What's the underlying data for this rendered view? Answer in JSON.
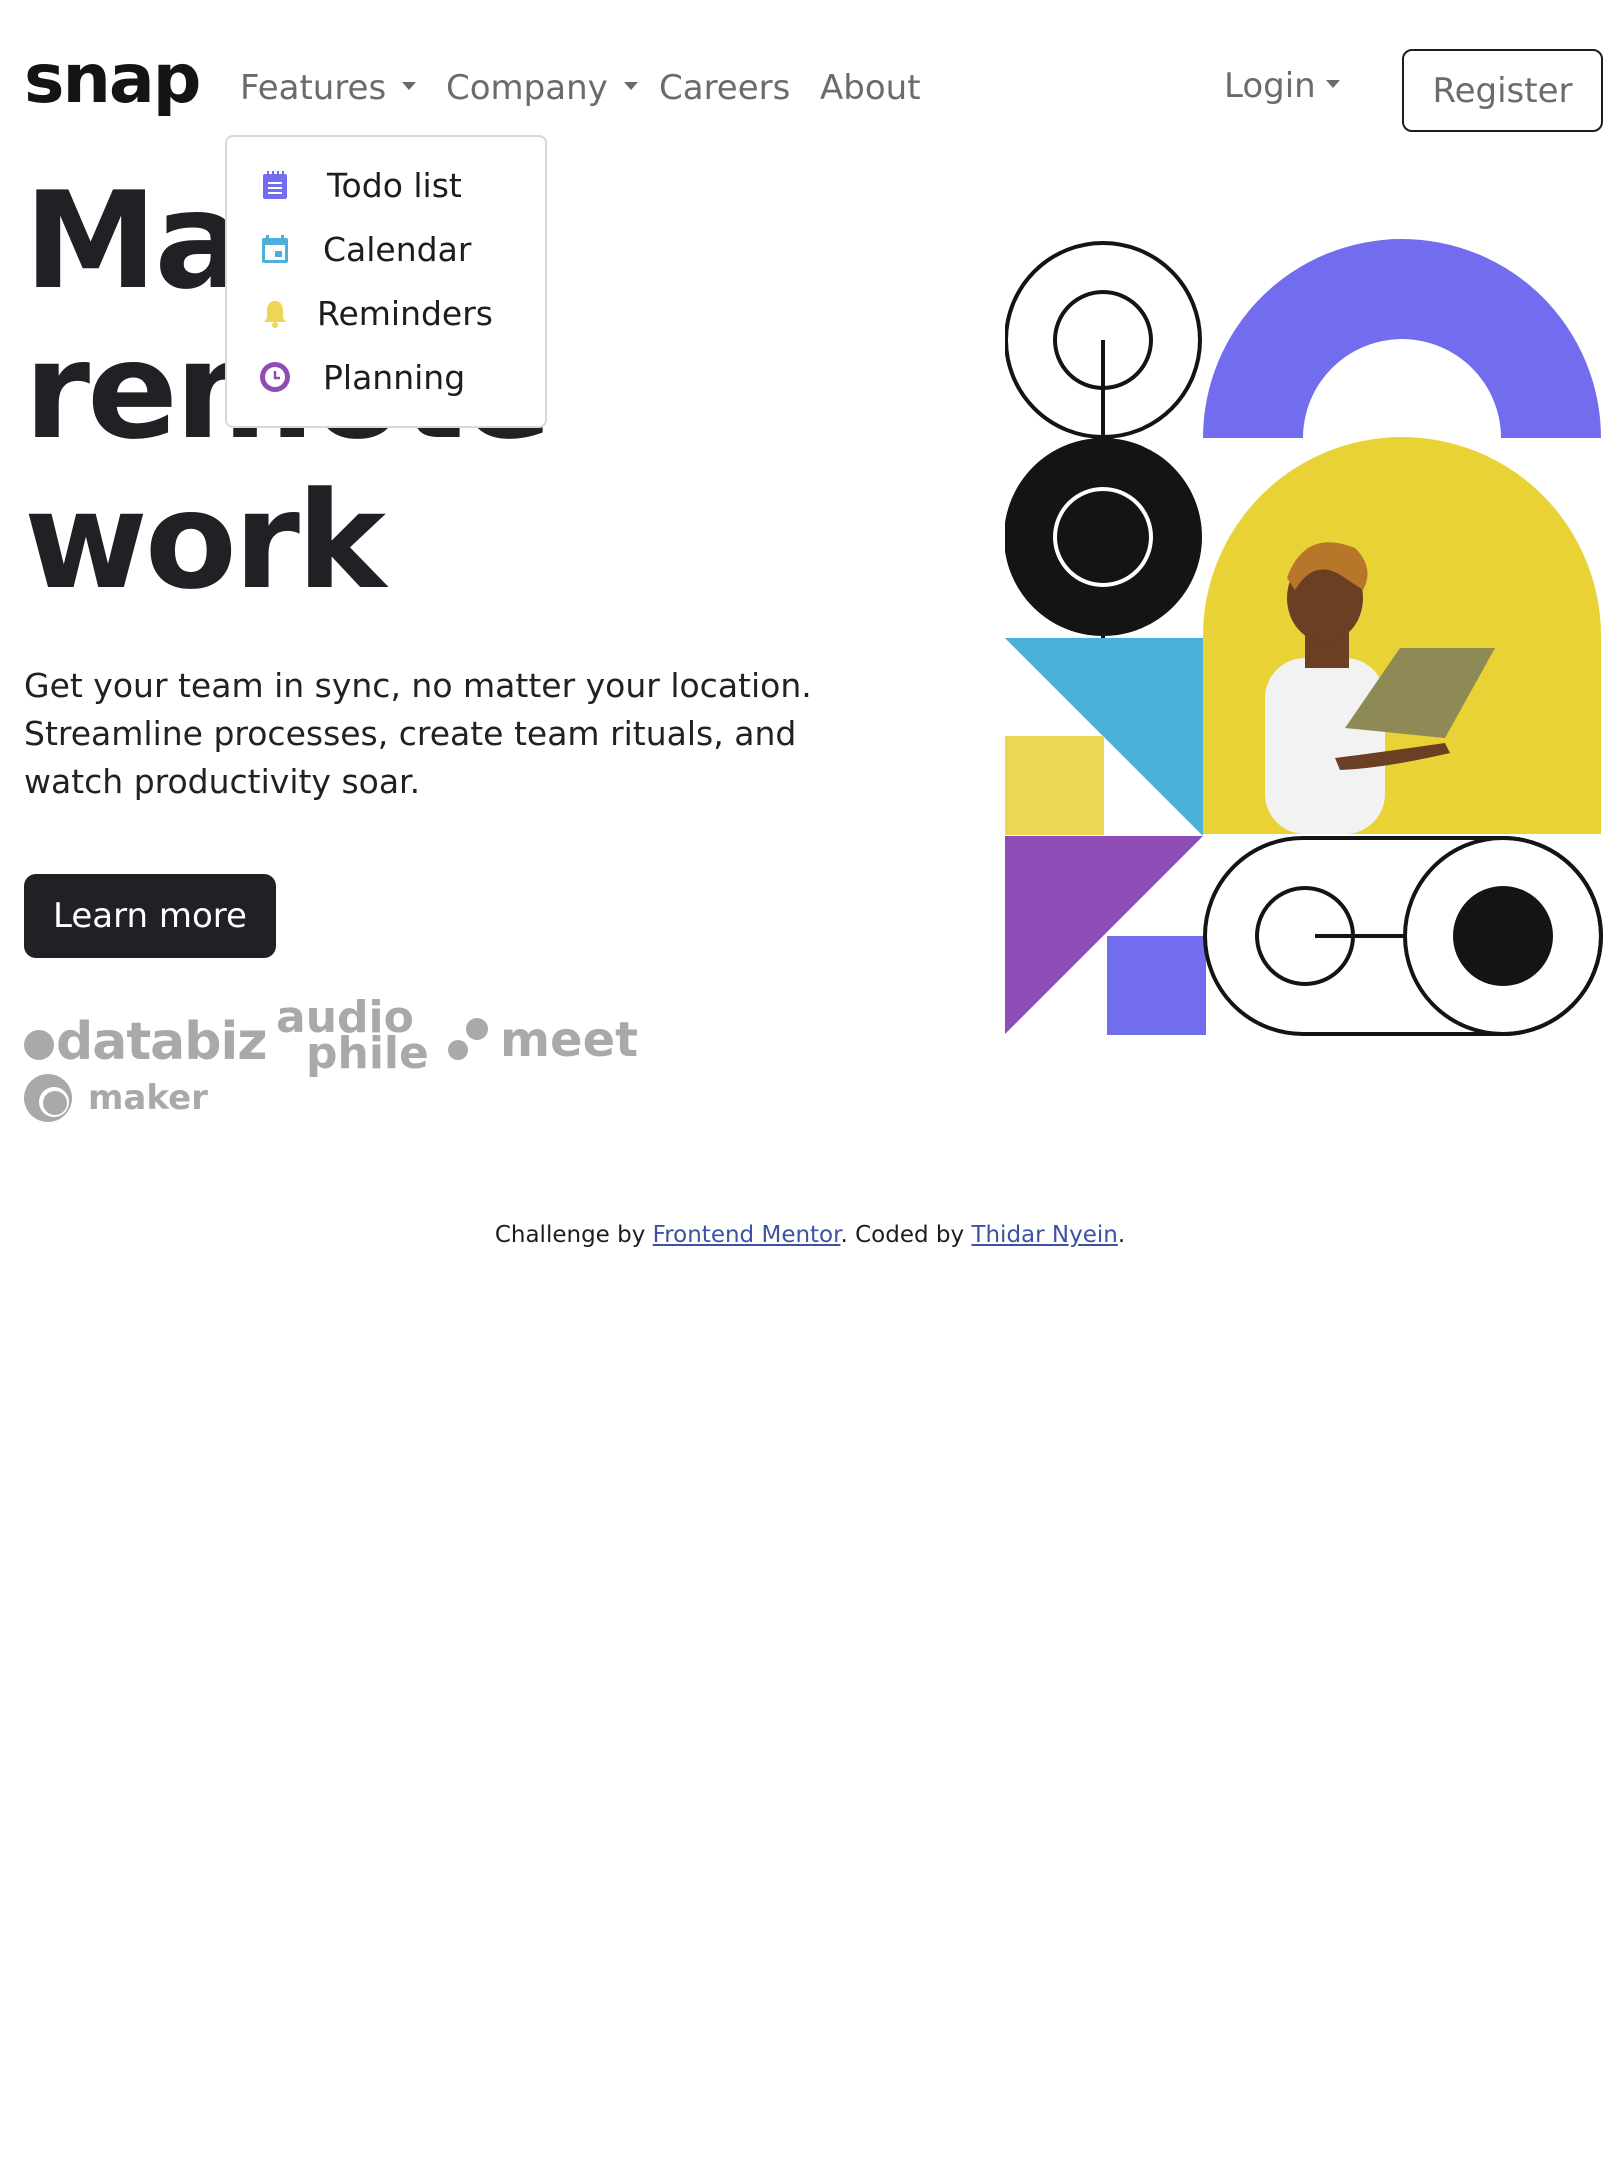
{
  "logo": "snap",
  "nav": {
    "features": "Features",
    "company": "Company",
    "careers": "Careers",
    "about": "About",
    "login": "Login",
    "register": "Register"
  },
  "features_menu": {
    "items": [
      {
        "label": "Todo list",
        "icon": "todo-icon",
        "color": "#726CEE"
      },
      {
        "label": "Calendar",
        "icon": "calendar-icon",
        "color": "#4BB1DA"
      },
      {
        "label": "Reminders",
        "icon": "bell-icon",
        "color": "#EDD556"
      },
      {
        "label": "Planning",
        "icon": "clock-icon",
        "color": "#8E4CB6"
      }
    ]
  },
  "hero": {
    "headline": [
      "Make",
      "remote",
      "work"
    ],
    "subtext": "Get your team in sync, no matter your location. Streamline processes, create team rituals, and watch productivity soar.",
    "cta": "Learn more"
  },
  "clients": [
    "databiz",
    "audio",
    "phile",
    "meet",
    "maker"
  ],
  "footer": {
    "prefix": "Challenge by ",
    "link1": "Frontend Mentor",
    "middle": ". Coded by ",
    "link2": "Thidar Nyein",
    "suffix": "."
  },
  "colors": {
    "dark": "#1F2125",
    "gray": "#6B6B6B",
    "purple": "#726CEE",
    "blue": "#4BB1DA",
    "yellow": "#EDD556",
    "violet": "#8E4CB6"
  }
}
